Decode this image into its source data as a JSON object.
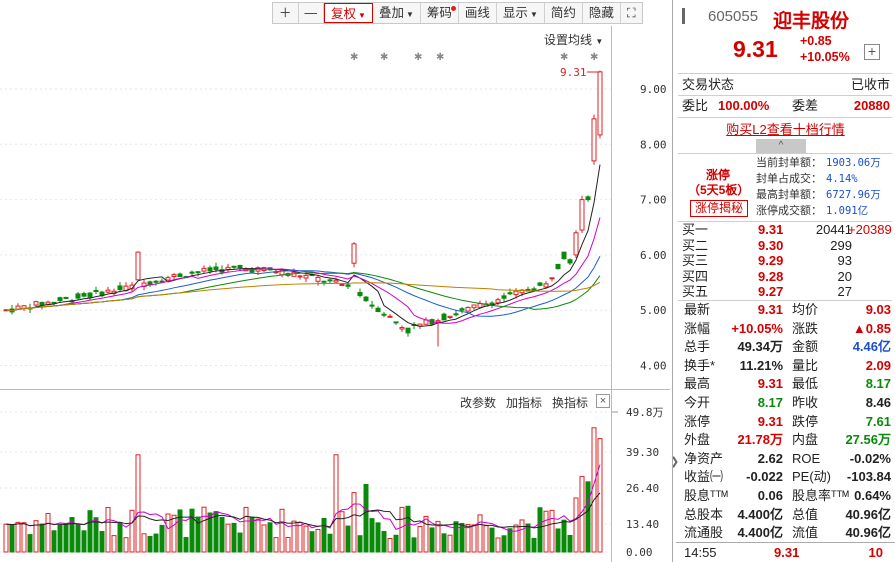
{
  "toolbar": {
    "plus": "＋",
    "minus": "—",
    "fuquan": "复权",
    "diejia": "叠加",
    "chouma": "筹码",
    "huaxian": "画线",
    "xianshi": "显示",
    "jianyue": "简约",
    "yincang": "隐藏",
    "fullscreen": "⛶"
  },
  "chart": {
    "set_ma": "设置均线",
    "last_price_tag": "9.31",
    "price_ticks": [
      "9.00",
      "8.00",
      "7.00",
      "6.00",
      "5.00",
      "4.00"
    ],
    "vol_ticks": [
      "49.8万",
      "39.30",
      "26.40",
      "13.40",
      "0.00"
    ],
    "vol_menu": [
      "改参数",
      "加指标",
      "换指标"
    ],
    "vol_close": "×",
    "colors": {
      "up": "#e02020",
      "down": "#0a8a0a",
      "ma5": "#222222",
      "ma10": "#d000d0",
      "ma20": "#1a5fd0",
      "ma30": "#0a8a0a",
      "ma60": "#c08000"
    }
  },
  "quote": {
    "code": "605055",
    "name": "迎丰股份",
    "price": "9.31",
    "change": "+0.85",
    "change_pct": "+10.05%",
    "plus_btn": "+",
    "status_label": "交易状态",
    "status_value": "已收市",
    "weibi_label": "委比",
    "weibi_value": "100.00%",
    "weicha_label": "委差",
    "weicha_value": "20880",
    "l2_link": "购买L2查看十档行情",
    "l2_tab": "^",
    "zt_title": "涨停",
    "zt_days": "（5天5板）",
    "zt_btn": "涨停揭秘",
    "seal": [
      {
        "k": "当前封单额：",
        "v": "1903.06万"
      },
      {
        "k": "封单占成交：",
        "v": "4.14%"
      },
      {
        "k": "最高封单额：",
        "v": "6727.96万"
      },
      {
        "k": "涨停成交额：",
        "v": "1.091亿"
      }
    ],
    "bids": [
      {
        "n": "买一",
        "p": "9.31",
        "v": "20441",
        "d": "+20389"
      },
      {
        "n": "买二",
        "p": "9.30",
        "v": "299",
        "d": ""
      },
      {
        "n": "买三",
        "p": "9.29",
        "v": "93",
        "d": ""
      },
      {
        "n": "买四",
        "p": "9.28",
        "v": "20",
        "d": ""
      },
      {
        "n": "买五",
        "p": "9.27",
        "v": "27",
        "d": ""
      }
    ],
    "stats": [
      {
        "k1": "最新",
        "v1": "9.31",
        "c1": "red",
        "k2": "均价",
        "v2": "9.03",
        "c2": "red"
      },
      {
        "k1": "涨幅",
        "v1": "+10.05%",
        "c1": "red",
        "k2": "涨跌",
        "v2": "▲0.85",
        "c2": "red"
      },
      {
        "k1": "总手",
        "v1": "49.34万",
        "c1": "",
        "k2": "金额",
        "v2": "4.46亿",
        "c2": "blue"
      },
      {
        "k1": "换手*",
        "v1": "11.21%",
        "c1": "",
        "k2": "量比",
        "v2": "2.09",
        "c2": "red"
      },
      {
        "k1": "最高",
        "v1": "9.31",
        "c1": "red",
        "k2": "最低",
        "v2": "8.17",
        "c2": "green"
      },
      {
        "k1": "今开",
        "v1": "8.17",
        "c1": "green",
        "k2": "昨收",
        "v2": "8.46",
        "c2": ""
      },
      {
        "k1": "涨停",
        "v1": "9.31",
        "c1": "red",
        "k2": "跌停",
        "v2": "7.61",
        "c2": "green"
      },
      {
        "k1": "外盘",
        "v1": "21.78万",
        "c1": "red",
        "k2": "内盘",
        "v2": "27.56万",
        "c2": "green"
      },
      {
        "k1": "净资产",
        "v1": "2.62",
        "c1": "",
        "k2": "ROE",
        "v2": "-0.02%",
        "c2": ""
      },
      {
        "k1": "收益㈠",
        "v1": "-0.022",
        "c1": "",
        "k2": "PE(动)",
        "v2": "-103.84",
        "c2": ""
      },
      {
        "k1": "股息ᵀᵀᴹ",
        "v1": "0.06",
        "c1": "",
        "k2": "股息率ᵀᵀᴹ",
        "v2": "0.64%",
        "c2": ""
      },
      {
        "k1": "总股本",
        "v1": "4.400亿",
        "c1": "",
        "k2": "总值",
        "v2": "40.96亿",
        "c2": ""
      },
      {
        "k1": "流通股",
        "v1": "4.400亿",
        "c1": "",
        "k2": "流值",
        "v2": "40.96亿",
        "c2": ""
      }
    ],
    "footer": {
      "time": "14:55",
      "price": "9.31",
      "vol": "10"
    }
  }
}
